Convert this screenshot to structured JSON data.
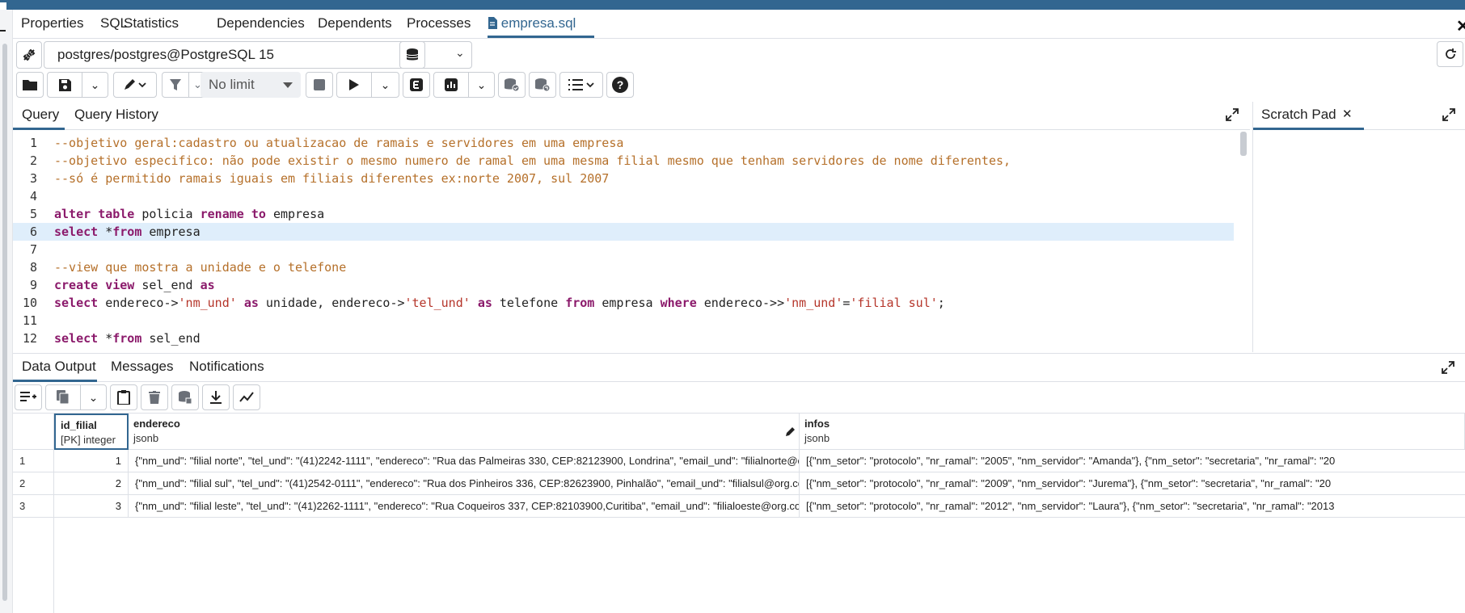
{
  "top_tabs": [
    "Properties",
    "SQL",
    "Statistics",
    "Dependencies",
    "Dependents",
    "Processes"
  ],
  "active_tab": "empresa.sql",
  "connection": "postgres/postgres@PostgreSQL 15",
  "toolbar": {
    "limit": "No limit"
  },
  "editor_tabs": {
    "query": "Query",
    "history": "Query History"
  },
  "scratch_pad": {
    "title": "Scratch Pad"
  },
  "code_lines": [
    {
      "n": "1",
      "text": "--objetivo geral:cadastro ou atualizacao de ramais e servidores em uma empresa"
    },
    {
      "n": "2",
      "text": "--objetivo especifico: não pode existir o mesmo numero de ramal em uma mesma filial mesmo que tenham servidores de nome diferentes,"
    },
    {
      "n": "3",
      "text": "--só é permitido ramais iguais em filiais diferentes ex:norte 2007, sul 2007"
    },
    {
      "n": "4",
      "text": ""
    },
    {
      "n": "5",
      "text": "alter table policia rename to empresa"
    },
    {
      "n": "6",
      "text": "select *from empresa"
    },
    {
      "n": "7",
      "text": ""
    },
    {
      "n": "8",
      "text": "--view que mostra a unidade e o telefone"
    },
    {
      "n": "9",
      "text": "create view sel_end as"
    },
    {
      "n": "10",
      "text": "select endereco->'nm_und' as unidade, endereco->'tel_und' as telefone from empresa where endereco->>'nm_und'='filial sul';"
    },
    {
      "n": "11",
      "text": ""
    },
    {
      "n": "12",
      "text": "select *from sel_end"
    }
  ],
  "result_tabs": [
    "Data Output",
    "Messages",
    "Notifications"
  ],
  "grid": {
    "columns": [
      {
        "name": "id_filial",
        "type": "[PK] integer"
      },
      {
        "name": "endereco",
        "type": "jsonb"
      },
      {
        "name": "infos",
        "type": "jsonb"
      }
    ],
    "rows": [
      {
        "rn": "1",
        "id": "1",
        "endereco": "{\"nm_und\": \"filial norte\", \"tel_und\": \"(41)2242-1111\", \"endereco\": \"Rua das Palmeiras 330, CEP:82123900, Londrina\", \"email_und\": \"filialnorte@org.com\"}",
        "infos": "[{\"nm_setor\": \"protocolo\", \"nr_ramal\": \"2005\", \"nm_servidor\": \"Amanda\"}, {\"nm_setor\": \"secretaria\", \"nr_ramal\": \"20"
      },
      {
        "rn": "2",
        "id": "2",
        "endereco": "{\"nm_und\": \"filial sul\", \"tel_und\": \"(41)2542-0111\", \"endereco\": \"Rua dos Pinheiros 336, CEP:82623900, Pinhalão\", \"email_und\": \"filialsul@org.com\"}",
        "infos": "[{\"nm_setor\": \"protocolo\", \"nr_ramal\": \"2009\", \"nm_servidor\": \"Jurema\"}, {\"nm_setor\": \"secretaria\", \"nr_ramal\": \"20"
      },
      {
        "rn": "3",
        "id": "3",
        "endereco": "{\"nm_und\": \"filial leste\", \"tel_und\": \"(41)2262-1111\", \"endereco\": \"Rua Coqueiros 337, CEP:82103900,Curitiba\", \"email_und\": \"filialoeste@org.com\"}",
        "infos": "[{\"nm_setor\": \"protocolo\", \"nr_ramal\": \"2012\", \"nm_servidor\": \"Laura\"}, {\"nm_setor\": \"secretaria\", \"nr_ramal\": \"2013"
      }
    ]
  },
  "colors": {
    "accent": "#326690",
    "current_line": "#dfeefb",
    "comment": "#b5702a",
    "keyword": "#8b1a6b",
    "string": "#b5352a"
  }
}
